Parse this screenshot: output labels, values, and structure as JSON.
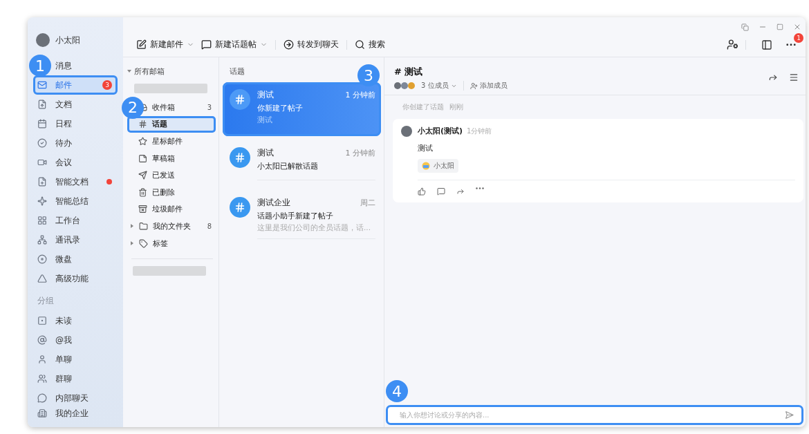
{
  "user": {
    "name": "小太阳"
  },
  "nav": [
    {
      "label": "消息",
      "selected": false,
      "dot": false
    },
    {
      "label": "邮件",
      "selected": true,
      "dot": false,
      "badge": "3",
      "callout": "1"
    },
    {
      "label": "文档",
      "selected": false,
      "dot": false
    },
    {
      "label": "日程",
      "selected": false,
      "dot": false
    },
    {
      "label": "待办",
      "selected": false,
      "dot": false
    },
    {
      "label": "会议",
      "selected": false,
      "dot": false
    },
    {
      "label": "智能文档",
      "selected": false,
      "dot": true
    },
    {
      "label": "智能总结",
      "selected": false,
      "dot": false
    },
    {
      "label": "工作台",
      "selected": false,
      "dot": false
    },
    {
      "label": "通讯录",
      "selected": false,
      "dot": false
    },
    {
      "label": "微盘",
      "selected": false,
      "dot": false
    },
    {
      "label": "高级功能",
      "selected": false,
      "dot": false
    }
  ],
  "groups_title": "分组",
  "groups": [
    {
      "label": "未读"
    },
    {
      "label": "@我"
    },
    {
      "label": "单聊"
    },
    {
      "label": "群聊"
    },
    {
      "label": "内部聊天"
    }
  ],
  "footer": {
    "label": "我的企业"
  },
  "toolbar": [
    {
      "label": "新建邮件",
      "menu": true
    },
    {
      "label": "新建话题帖",
      "menu": true
    },
    {
      "label": "转发到聊天",
      "menu": false
    },
    {
      "label": "搜索",
      "menu": false
    }
  ],
  "notification_badge": "1",
  "folders": {
    "header": "所有邮箱",
    "items": [
      {
        "label": "收件箱",
        "count": "3",
        "selected": false,
        "expandable": false
      },
      {
        "label": "话题",
        "selected": true,
        "expandable": false,
        "callout": "2"
      },
      {
        "label": "星标邮件",
        "selected": false,
        "expandable": false
      },
      {
        "label": "草稿箱",
        "selected": false,
        "expandable": false
      },
      {
        "label": "已发送",
        "selected": false,
        "expandable": false
      },
      {
        "label": "已删除",
        "selected": false,
        "expandable": false
      },
      {
        "label": "垃圾邮件",
        "selected": false,
        "expandable": false
      },
      {
        "label": "我的文件夹",
        "count": "8",
        "selected": false,
        "expandable": true
      },
      {
        "label": "标签",
        "selected": false,
        "expandable": true
      }
    ]
  },
  "topics": {
    "header": "话题",
    "items": [
      {
        "title": "测试",
        "time": "1 分钟前",
        "preview": "你新建了帖子",
        "snippet": "测试",
        "selected": true,
        "callout": "3"
      },
      {
        "title": "测试",
        "time": "1 分钟前",
        "preview": "小太阳已解散话题",
        "selected": false
      },
      {
        "title": "测试企业",
        "time": "周二",
        "preview": "话题小助手新建了帖子",
        "snippet": "这里是我们公司的全员话题，话...",
        "selected": false
      }
    ]
  },
  "conversation": {
    "title": "# 测试",
    "members": "3 位成员",
    "add_member": "添加成员",
    "system_note": {
      "text": "你创建了话题",
      "time": "刚刚"
    },
    "post": {
      "author": "小太阳(测试)",
      "time": "1分钟前",
      "body": "测试",
      "reaction": "小太阳"
    },
    "input": {
      "placeholder": "输入你想讨论或分享的内容...",
      "callout": "4"
    }
  }
}
